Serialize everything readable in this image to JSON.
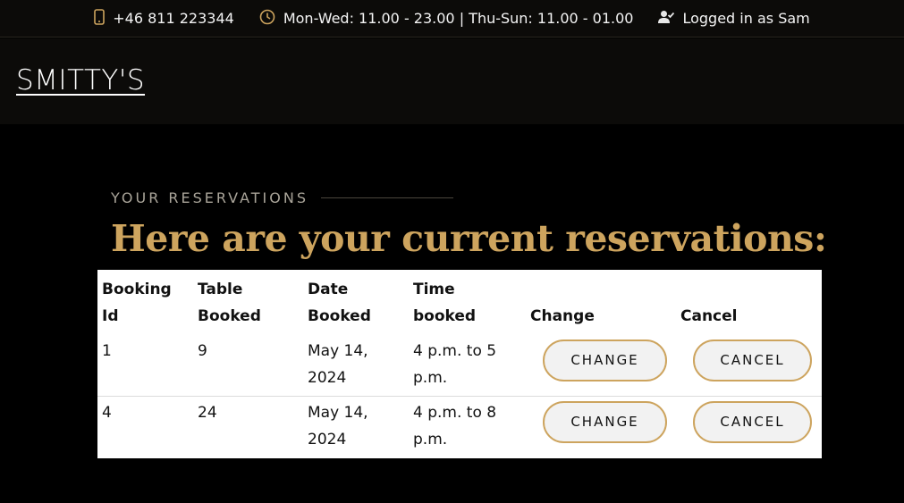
{
  "topbar": {
    "phone": "+46 811 223344",
    "hours": "Mon-Wed: 11.00 - 23.00 | Thu-Sun: 11.00 - 01.00",
    "user": "Logged in as Sam"
  },
  "header": {
    "logo": "SMITTY'S"
  },
  "section": {
    "kicker": "Your Reservations",
    "headline": "Here are your current reservations:"
  },
  "table": {
    "headers": [
      "Booking Id",
      "Table Booked",
      "Date Booked",
      "Time booked",
      "Change",
      "Cancel"
    ],
    "rows": [
      {
        "id": "1",
        "table": "9",
        "date": "May 14, 2024",
        "time": "4 p.m. to 5 p.m.",
        "change_label": "Change",
        "cancel_label": "Cancel"
      },
      {
        "id": "4",
        "table": "24",
        "date": "May 14, 2024",
        "time": "4 p.m. to 8 p.m.",
        "change_label": "Change",
        "cancel_label": "Cancel"
      }
    ]
  },
  "colors": {
    "accent": "#cda45e",
    "background": "#000000",
    "header_bg": "#0c0b09"
  }
}
